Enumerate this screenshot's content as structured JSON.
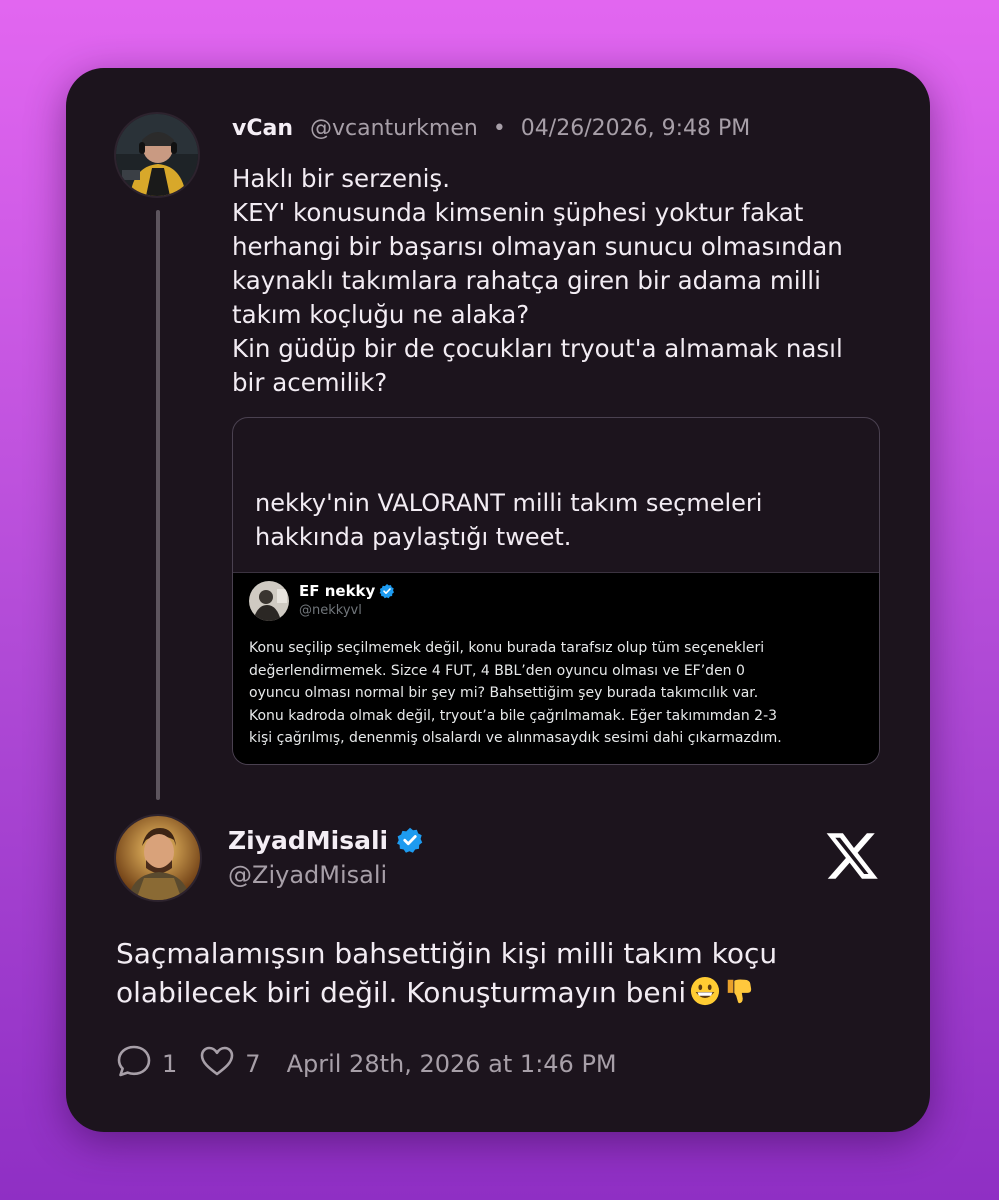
{
  "original_tweet": {
    "display_name": "vCan",
    "handle": "@vcanturkmen",
    "separator": "•",
    "timestamp": "04/26/2026, 9:48 PM",
    "lines": [
      "Haklı bir serzeniş.",
      "KEY' konusunda kimsenin şüphesi yoktur fakat",
      "herhangi bir başarısı olmayan sunucu olmasından",
      "kaynaklı takımlara rahatça giren bir adama milli",
      "takım koçluğu ne alaka?",
      "Kin güdüp bir de çocukları tryout'a almamak nasıl",
      "bir acemilik?"
    ],
    "quote_caption": [
      "nekky'nin VALORANT milli takım seçmeleri",
      "hakkında paylaştığı tweet."
    ]
  },
  "embedded_tweet": {
    "display_name": "EF nekky",
    "handle": "@nekkyvl",
    "lines": [
      "Konu seçilip seçilmemek değil, konu burada tarafsız olup tüm seçenekleri",
      "değerlendirmemek. Sizce 4 FUT, 4 BBL’den oyuncu olması ve EF’den 0",
      "oyuncu olması normal bir şey mi? Bahsettiğim şey burada takımcılık var.",
      "Konu kadroda olmak değil, tryout’a bile çağrılmamak. Eğer takımımdan 2-3",
      "kişi çağrılmış, denenmiş olsalardı ve alınmasaydık sesimi dahi çıkarmazdım."
    ]
  },
  "reply": {
    "display_name": "ZiyadMisali",
    "handle": "@ZiyadMisali",
    "lines": [
      "Saçmalamışsın bahsettiğin kişi milli takım koçu",
      "olabilecek biri değil. Konuşturmayın beni"
    ],
    "emojis": [
      "grinning-face",
      "thumbs-down"
    ],
    "reply_count": "1",
    "like_count": "7",
    "date": "April 28th, 2026 at 1:46 PM"
  },
  "colors": {
    "card_bg": "#1c141d",
    "verified_blue": "#1d9bf0",
    "muted_text": "#a79fa8"
  }
}
